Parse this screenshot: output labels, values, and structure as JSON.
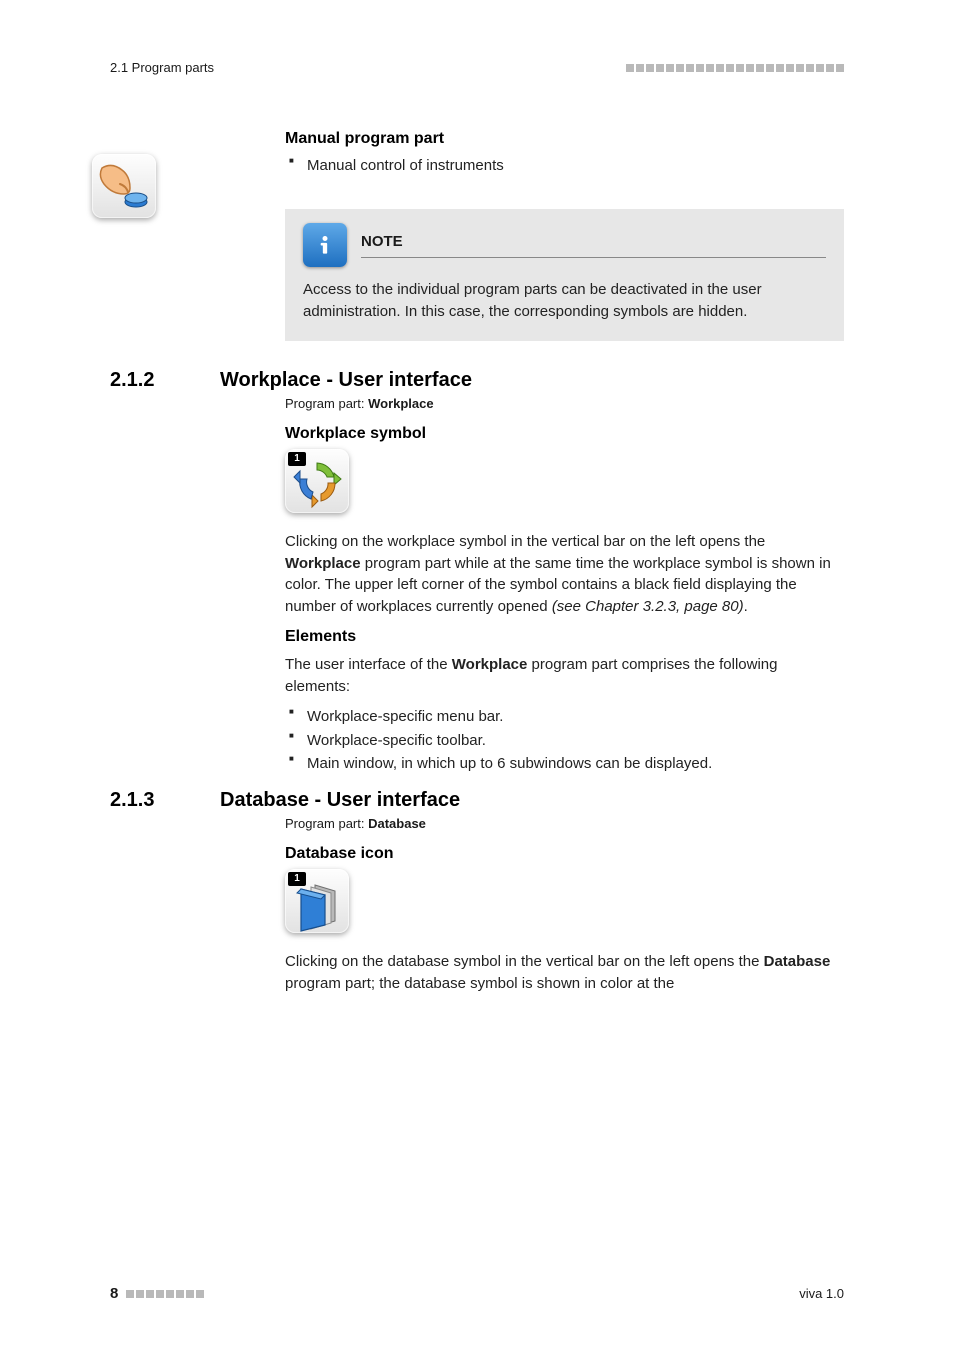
{
  "header": {
    "section_path": "2.1 Program parts"
  },
  "manual": {
    "heading": "Manual program part",
    "bullets": [
      "Manual control of instruments"
    ]
  },
  "note": {
    "label": "NOTE",
    "text": "Access to the individual program parts can be deactivated in the user administration. In this case, the corresponding symbols are hidden."
  },
  "sec_workplace": {
    "num": "2.1.2",
    "title": "Workplace - User interface",
    "program_part_prefix": "Program part: ",
    "program_part_name": "Workplace",
    "symbol_heading": "Workplace symbol",
    "badge": "1",
    "para_pre": "Clicking on the workplace symbol in the vertical bar on the left opens the ",
    "para_bold": "Workplace",
    "para_mid": " program part while at the same time the workplace symbol is shown in color. The upper left corner of the symbol contains a black field displaying the number of workplaces currently opened ",
    "para_italic": "(see Chapter 3.2.3, page 80)",
    "para_end": ".",
    "elements_heading": "Elements",
    "elements_intro_pre": "The user interface of the ",
    "elements_intro_bold": "Workplace",
    "elements_intro_post": " program part comprises the following elements:",
    "elements_bullets": [
      "Workplace-specific menu bar.",
      "Workplace-specific toolbar.",
      "Main window, in which up to 6 subwindows can be displayed."
    ]
  },
  "sec_database": {
    "num": "2.1.3",
    "title": "Database - User interface",
    "program_part_prefix": "Program part: ",
    "program_part_name": "Database",
    "icon_heading": "Database icon",
    "badge": "1",
    "para_pre": "Clicking on the database symbol in the vertical bar on the left opens the ",
    "para_bold": "Database",
    "para_post": " program part; the database symbol is shown in color at the"
  },
  "footer": {
    "page": "8",
    "product": "viva 1.0"
  }
}
